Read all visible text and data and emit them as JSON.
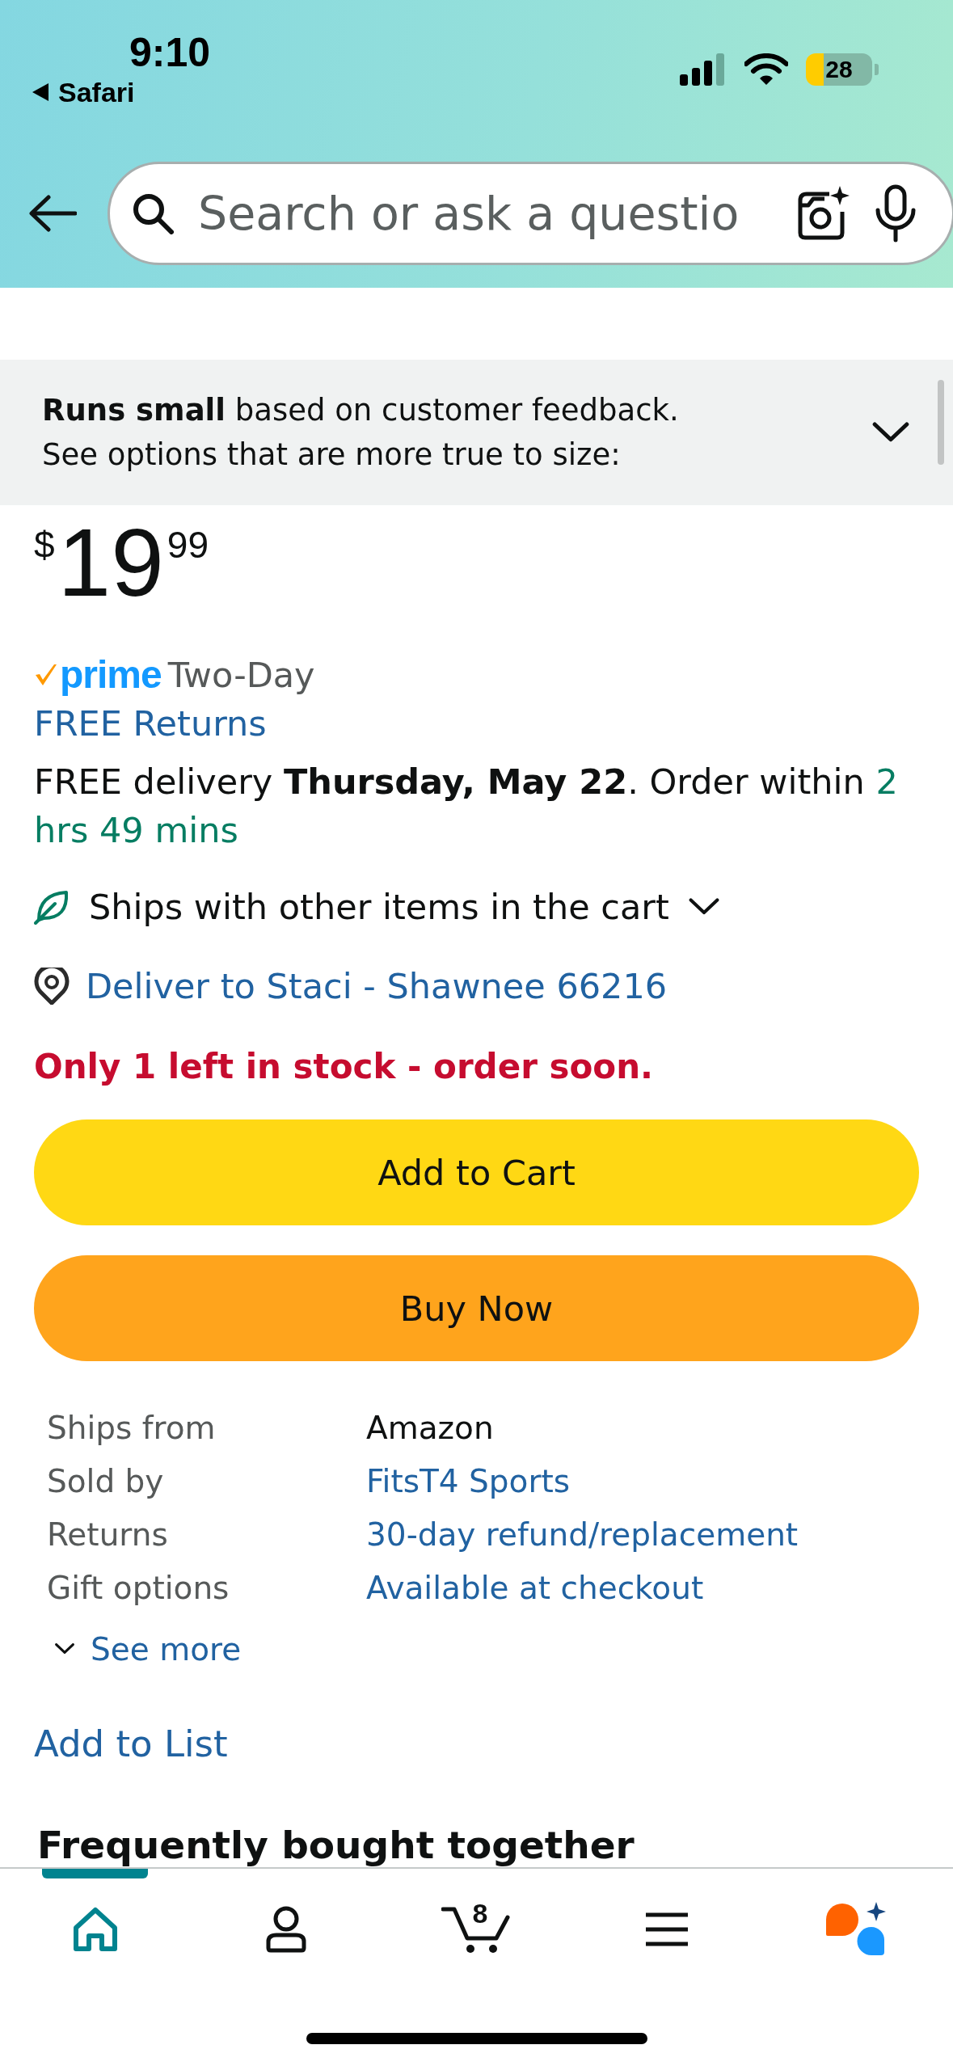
{
  "status_bar": {
    "time": "9:10",
    "back_app": "Safari",
    "battery": "28"
  },
  "search": {
    "placeholder": "Search or ask a questio"
  },
  "fit_banner": {
    "lines": [
      "**Runs small** based on customer feedback.",
      "See options that are more true to size:"
    ],
    "expanded": false
  },
  "price": {
    "currency": "$",
    "whole": "19",
    "fraction": "99"
  },
  "prime": {
    "logo": "prime",
    "label": "Two-Day"
  },
  "returns_link": "FREE Returns",
  "delivery": {
    "text": "FREE delivery **Thursday, May 22**. Order within",
    "countdown": "2 hrs 49 mins"
  },
  "ships_with": {
    "text": "Ships with other items in the cart",
    "expanded": false
  },
  "deliver_to": "Deliver to Staci - Shawnee 66216",
  "stock": "Only 1 left in stock - order soon.",
  "buttons": [
    {
      "kind": "cart",
      "label": "Add to Cart"
    },
    {
      "kind": "buy",
      "label": "Buy Now"
    }
  ],
  "details": [
    {
      "label": "Ships from",
      "value": "Amazon",
      "link": false
    },
    {
      "label": "Sold by",
      "value": "FitsT4 Sports",
      "link": true
    },
    {
      "label": "Returns",
      "value": "30-day refund/replacement",
      "link": true
    },
    {
      "label": "Gift options",
      "value": "Available at checkout",
      "link": true
    }
  ],
  "see_more": {
    "label": "See more",
    "expanded": false
  },
  "add_to_list": "Add to List",
  "section_heading": "Frequently bought together",
  "nav": [
    {
      "selected": true
    },
    {
      "selected": false
    },
    {
      "selected": false,
      "count": "8"
    },
    {
      "selected": false
    },
    {
      "selected": false
    }
  ]
}
